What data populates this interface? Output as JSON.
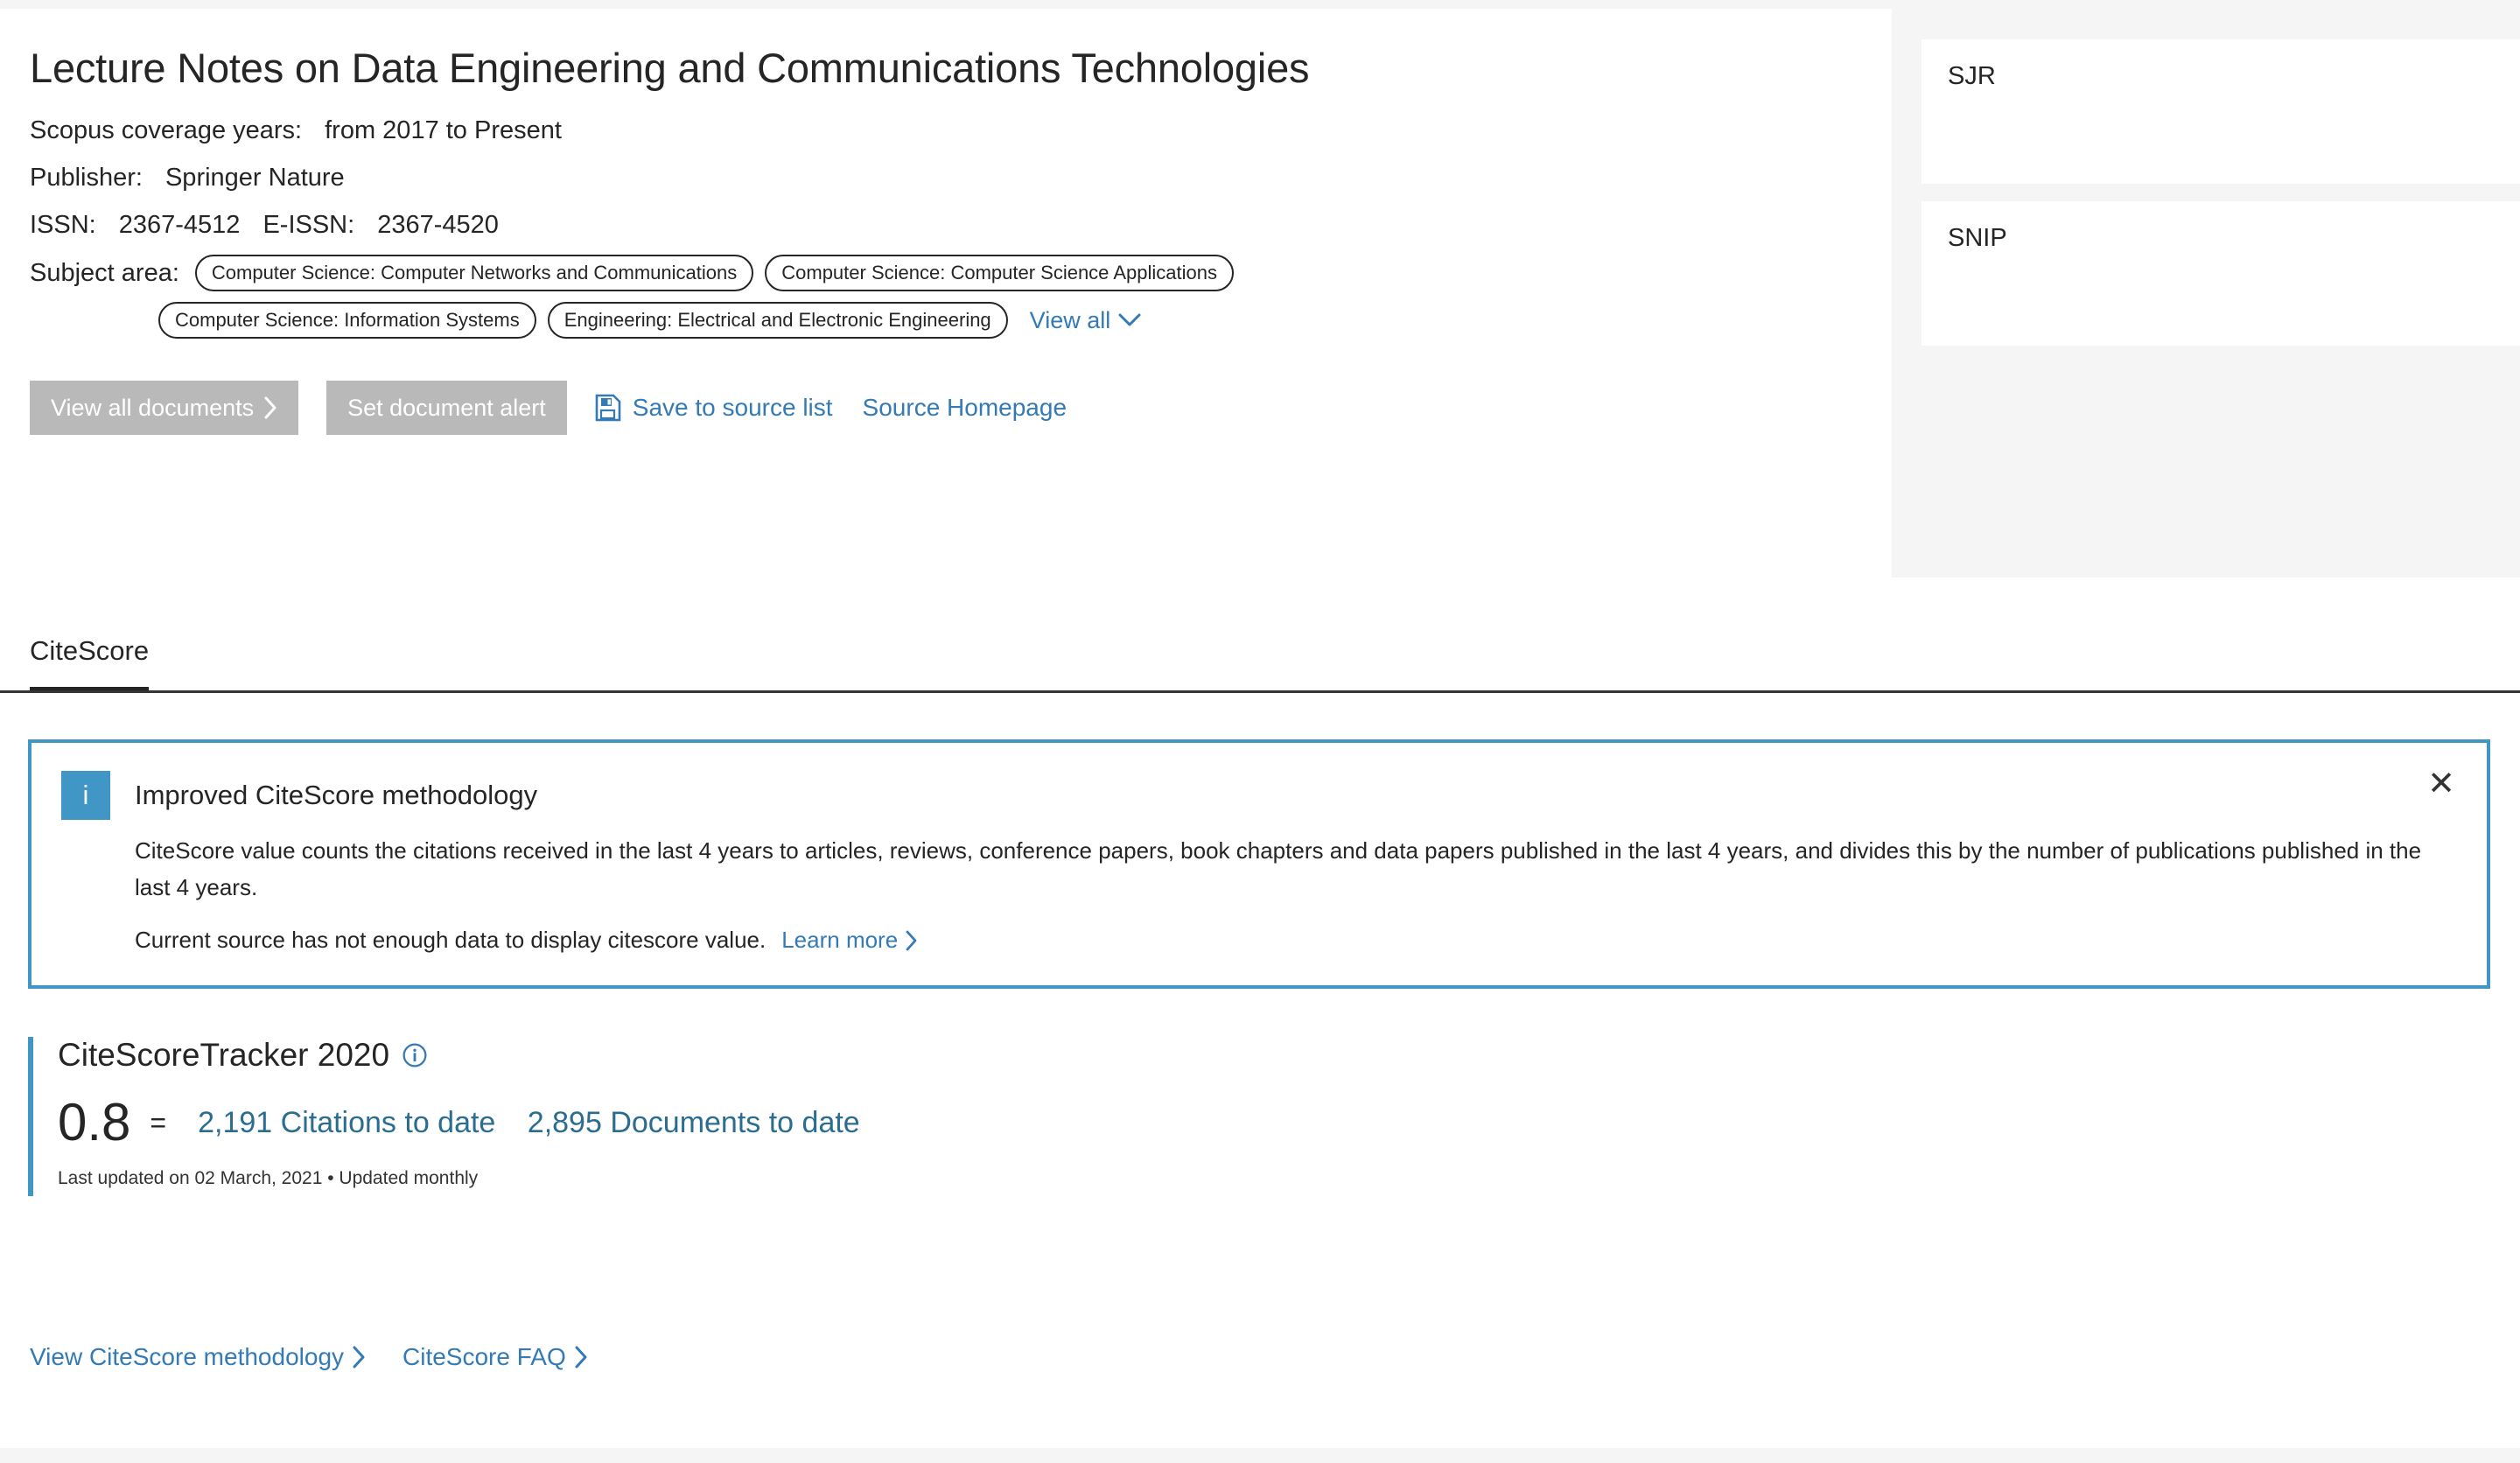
{
  "source": {
    "title": "Lecture Notes on Data Engineering and Communications Technologies",
    "coverage_label": "Scopus coverage years:",
    "coverage_value": "from 2017 to Present",
    "publisher_label": "Publisher:",
    "publisher_value": "Springer Nature",
    "issn_label": "ISSN:",
    "issn_value": "2367-4512",
    "eissn_label": "E-ISSN:",
    "eissn_value": "2367-4520",
    "subject_area_label": "Subject area:",
    "subject_tags": [
      "Computer Science: Computer Networks and Communications",
      "Computer Science: Computer Science Applications",
      "Computer Science: Information Systems",
      "Engineering: Electrical and Electronic Engineering"
    ],
    "view_all_label": "View all",
    "view_all_icon": "chevron-down-icon"
  },
  "actions": {
    "view_all_documents": "View all documents",
    "view_all_documents_icon": "chevron-right-icon",
    "set_document_alert": "Set document alert",
    "save_to_source_list": "Save to source list",
    "save_icon": "save-floppy-icon",
    "source_homepage": "Source Homepage"
  },
  "metrics": [
    {
      "label": "SJR",
      "info_icon": "info-circle-icon",
      "value": ""
    },
    {
      "label": "SNIP",
      "info_icon": "info-circle-icon",
      "value": ""
    }
  ],
  "tabs": [
    {
      "label": "CiteScore",
      "active": true
    }
  ],
  "notice": {
    "badge_icon": "info-badge-icon",
    "badge_glyph": "i",
    "title": "Improved CiteScore methodology",
    "paragraph": "CiteScore value counts the citations received in the last 4 years to articles, reviews, conference papers, book chapters and data papers published in the last 4 years, and divides this by the number of publications published in the last 4 years.",
    "status_text": "Current source has not enough data to display citescore value.",
    "learn_more": "Learn more",
    "learn_more_icon": "chevron-right-icon",
    "close_icon": "close-icon",
    "close_glyph": "✕"
  },
  "tracker": {
    "title": "CiteScoreTracker 2020",
    "info_icon": "info-circle-icon",
    "score": "0.8",
    "equals": "=",
    "numerator": "2,191 Citations to date",
    "denominator": "2,895 Documents to date",
    "updated": "Last updated on 02 March, 2021 • Updated monthly"
  },
  "footer": {
    "methodology_link": "View CiteScore methodology",
    "methodology_icon": "chevron-right-icon",
    "faq_link": "CiteScore FAQ",
    "faq_icon": "chevron-right-icon"
  },
  "colors": {
    "link_blue": "#337ab7",
    "notice_blue": "#4097c6",
    "tracker_accent": "#4097c6",
    "disabled_grey": "#b9b9b9",
    "page_bg": "#f5f5f5",
    "text": "#252525"
  }
}
